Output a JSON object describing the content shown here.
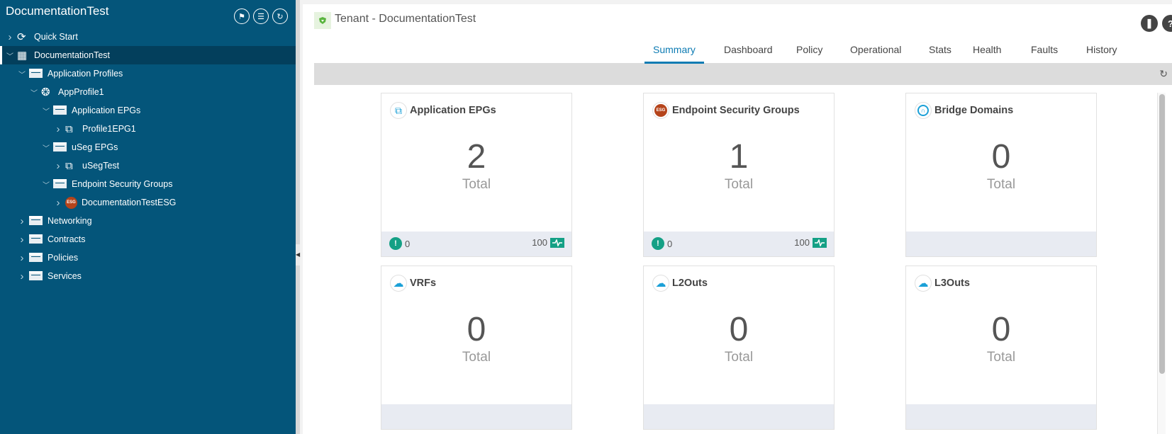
{
  "sidebar": {
    "title": "DocumentationTest",
    "buttons": [
      "flag-icon",
      "filter-icon",
      "refresh-icon"
    ],
    "tree": [
      {
        "label": "Quick Start",
        "level": 0,
        "icon": "quick-start-icon",
        "chev": "right"
      },
      {
        "label": "DocumentationTest",
        "level": 0,
        "icon": "tenant-icon",
        "chev": "down",
        "selected": true
      },
      {
        "label": "Application Profiles",
        "level": 1,
        "icon": "folder-icon",
        "chev": "down"
      },
      {
        "label": "AppProfile1",
        "level": 2,
        "icon": "app-profile-icon",
        "chev": "down"
      },
      {
        "label": "Application EPGs",
        "level": 3,
        "icon": "folder-icon",
        "chev": "down"
      },
      {
        "label": "Profile1EPG1",
        "level": 4,
        "icon": "epg-icon",
        "chev": "right"
      },
      {
        "label": "uSeg EPGs",
        "level": 3,
        "icon": "folder-icon",
        "chev": "down"
      },
      {
        "label": "uSegTest",
        "level": 4,
        "icon": "epg-icon",
        "chev": "right"
      },
      {
        "label": "Endpoint Security Groups",
        "level": 3,
        "icon": "folder-icon",
        "chev": "down"
      },
      {
        "label": "DocumentationTestESG",
        "level": 4,
        "icon": "esg-icon",
        "chev": "right"
      },
      {
        "label": "Networking",
        "level": 1,
        "icon": "folder-icon",
        "chev": "right"
      },
      {
        "label": "Contracts",
        "level": 1,
        "icon": "folder-icon",
        "chev": "right"
      },
      {
        "label": "Policies",
        "level": 1,
        "icon": "folder-icon",
        "chev": "right"
      },
      {
        "label": "Services",
        "level": 1,
        "icon": "folder-icon",
        "chev": "right"
      }
    ]
  },
  "header": {
    "title": "Tenant - DocumentationTest"
  },
  "tabs": [
    "Summary",
    "Dashboard",
    "Policy",
    "Operational",
    "Stats",
    "Health",
    "Faults",
    "History"
  ],
  "active_tab": "Summary",
  "cards": [
    {
      "title": "Application EPGs",
      "value": "2",
      "label": "Total",
      "icon": "epg-icon",
      "faults": "0",
      "health": "100"
    },
    {
      "title": "Endpoint Security Groups",
      "value": "1",
      "label": "Total",
      "icon": "esg-icon",
      "faults": "0",
      "health": "100"
    },
    {
      "title": "Bridge Domains",
      "value": "0",
      "label": "Total",
      "icon": "bridge-domain-icon"
    },
    {
      "title": "VRFs",
      "value": "0",
      "label": "Total",
      "icon": "vrf-icon"
    },
    {
      "title": "L2Outs",
      "value": "0",
      "label": "Total",
      "icon": "l2out-icon"
    },
    {
      "title": "L3Outs",
      "value": "0",
      "label": "Total",
      "icon": "l3out-icon"
    }
  ],
  "colors": {
    "sidebar": "#04557a",
    "accent": "#0d7bb3",
    "health": "#14a085",
    "esg": "#b5441b"
  }
}
